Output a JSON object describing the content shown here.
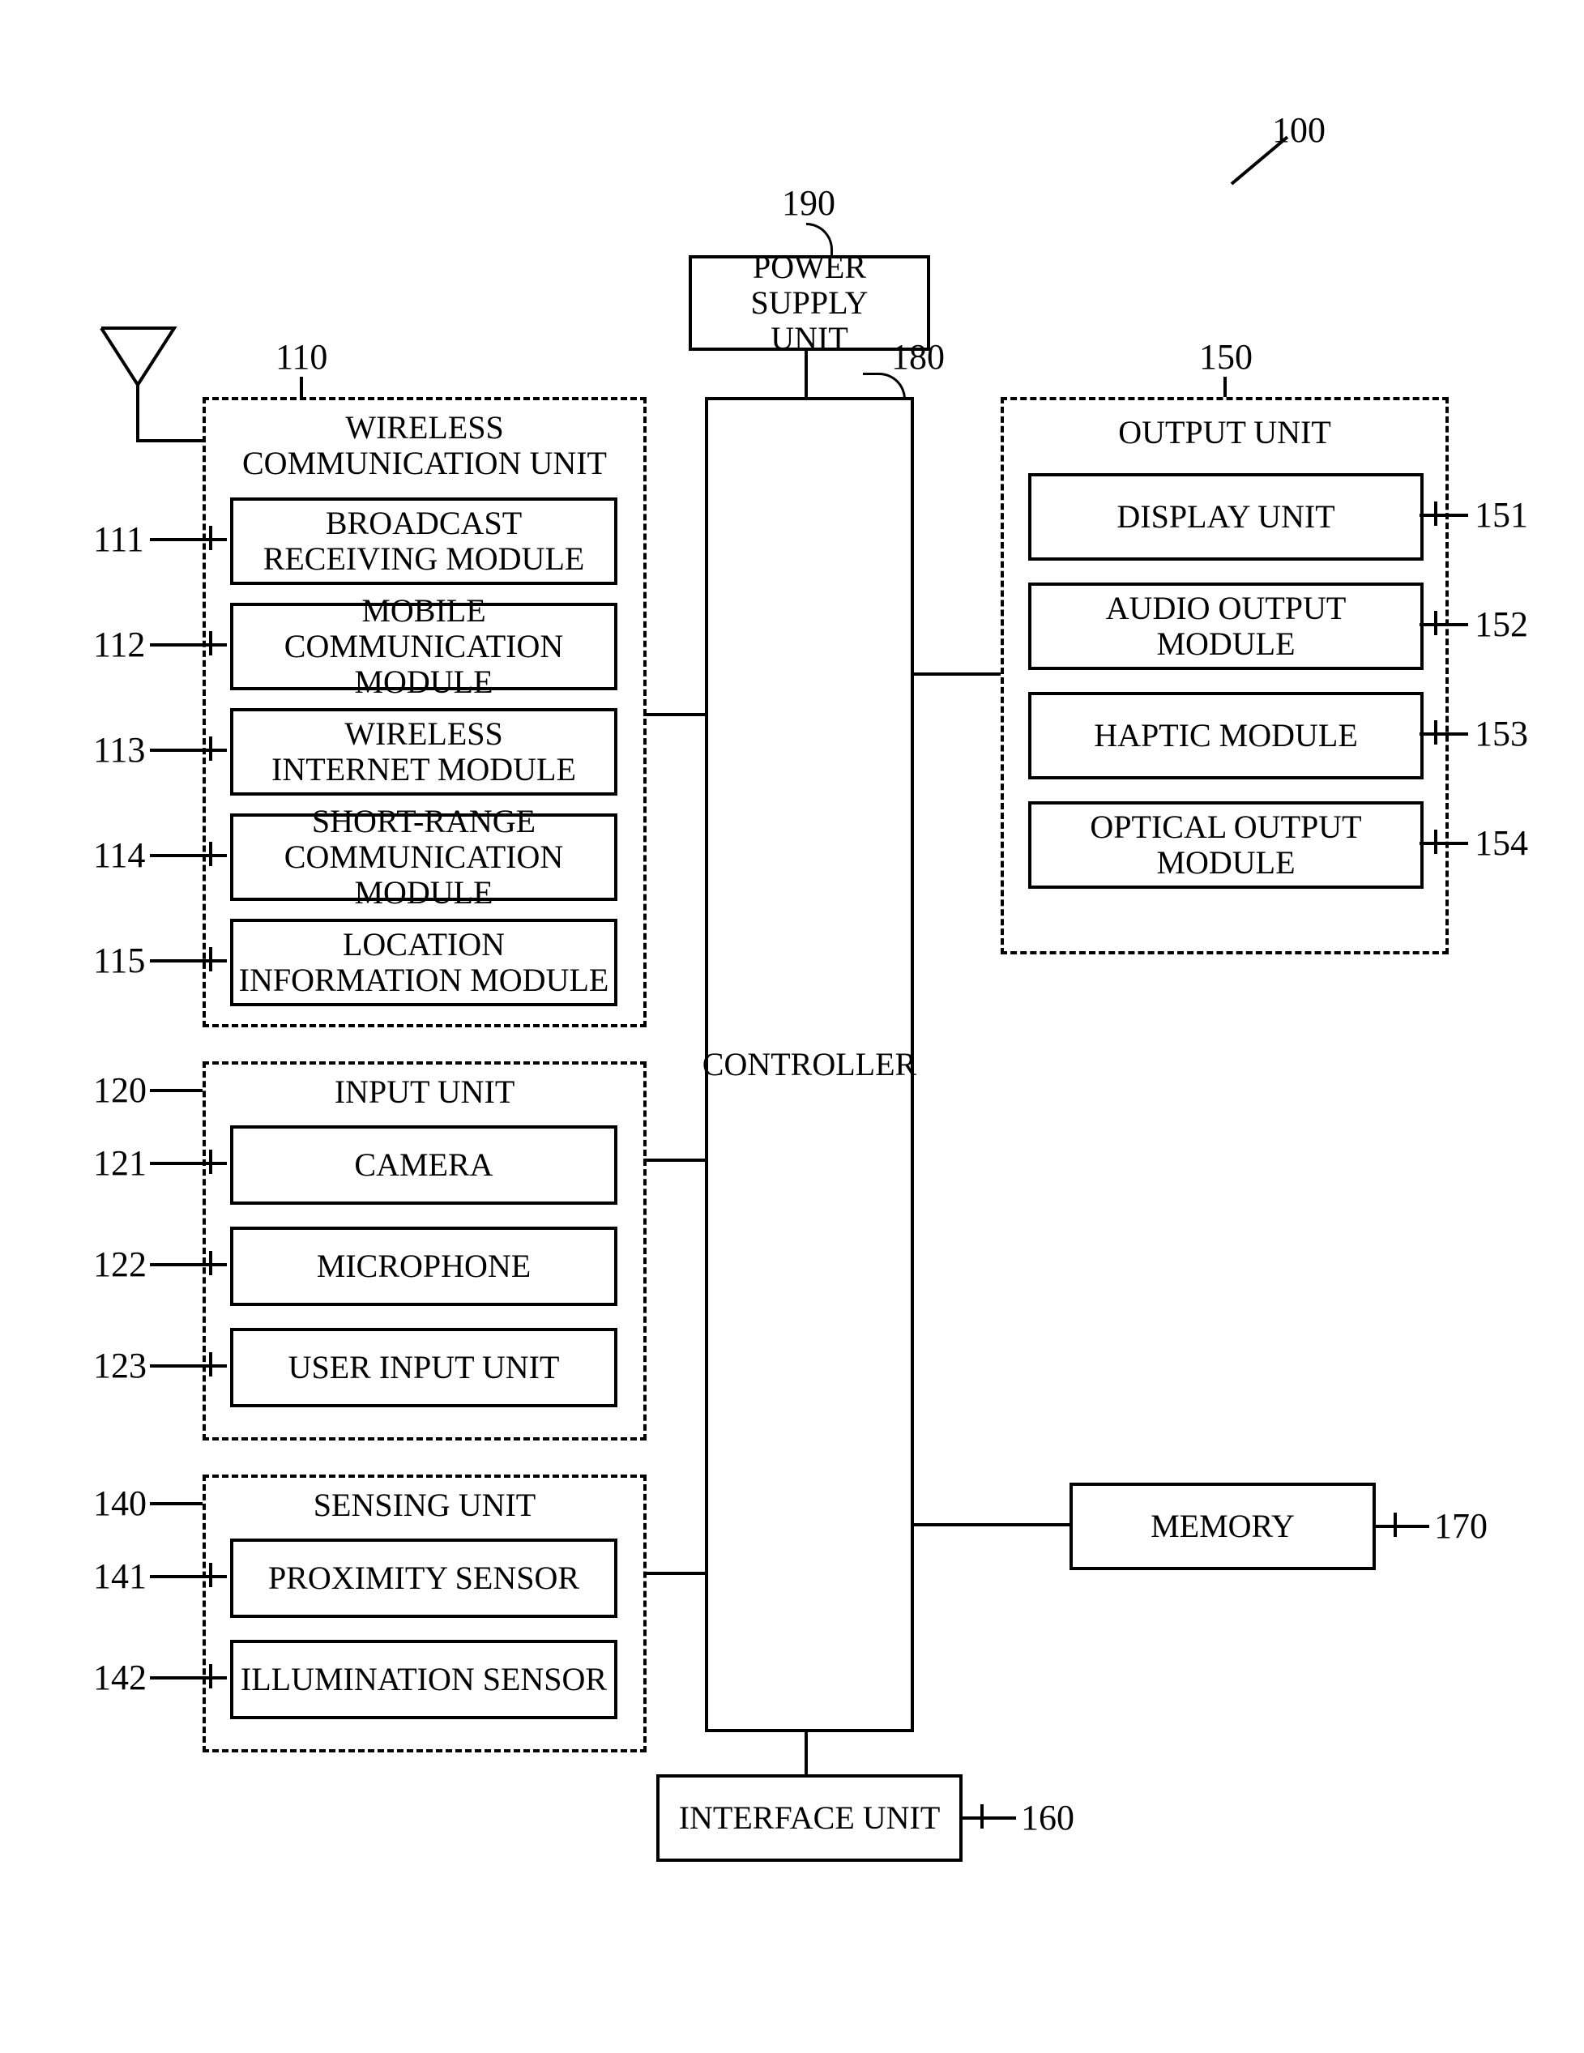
{
  "ref_top": "100",
  "power_supply": {
    "ref": "190",
    "label": "POWER SUPPLY\nUNIT"
  },
  "controller": {
    "ref": "180",
    "label": "CONTROLLER"
  },
  "wireless": {
    "ref": "110",
    "title": "WIRELESS\nCOMMUNICATION UNIT",
    "items": [
      {
        "ref": "111",
        "label": "BROADCAST\nRECEIVING MODULE"
      },
      {
        "ref": "112",
        "label": "MOBILE\nCOMMUNICATION MODULE"
      },
      {
        "ref": "113",
        "label": "WIRELESS\nINTERNET MODULE"
      },
      {
        "ref": "114",
        "label": "SHORT-RANGE\nCOMMUNICATION MODULE"
      },
      {
        "ref": "115",
        "label": "LOCATION\nINFORMATION MODULE"
      }
    ]
  },
  "input": {
    "ref": "120",
    "title": "INPUT UNIT",
    "items": [
      {
        "ref": "121",
        "label": "CAMERA"
      },
      {
        "ref": "122",
        "label": "MICROPHONE"
      },
      {
        "ref": "123",
        "label": "USER INPUT UNIT"
      }
    ]
  },
  "sensing": {
    "ref": "140",
    "title": "SENSING UNIT",
    "items": [
      {
        "ref": "141",
        "label": "PROXIMITY SENSOR"
      },
      {
        "ref": "142",
        "label": "ILLUMINATION SENSOR"
      }
    ]
  },
  "output": {
    "ref": "150",
    "title": "OUTPUT UNIT",
    "items": [
      {
        "ref": "151",
        "label": "DISPLAY UNIT"
      },
      {
        "ref": "152",
        "label": "AUDIO OUTPUT\nMODULE"
      },
      {
        "ref": "153",
        "label": "HAPTIC MODULE"
      },
      {
        "ref": "154",
        "label": "OPTICAL OUTPUT\nMODULE"
      }
    ]
  },
  "memory": {
    "ref": "170",
    "label": "MEMORY"
  },
  "interface": {
    "ref": "160",
    "label": "INTERFACE UNIT"
  }
}
